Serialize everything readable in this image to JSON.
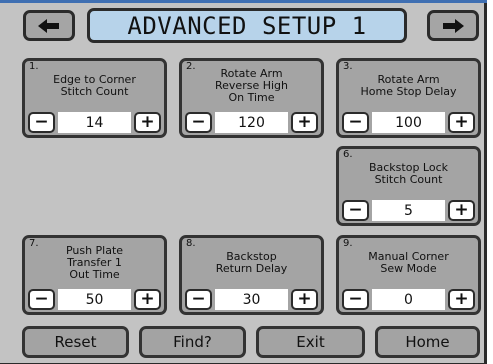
{
  "title": "ADVANCED SETUP 1",
  "nav": {
    "prev_icon": "arrow-left-icon",
    "next_icon": "arrow-right-icon"
  },
  "params": [
    {
      "num": "1.",
      "label": "Edge to Corner\nStitch Count",
      "value": "14"
    },
    {
      "num": "2.",
      "label": "Rotate Arm\nReverse High\nOn Time",
      "value": "120"
    },
    {
      "num": "3.",
      "label": "Rotate Arm\nHome Stop Delay",
      "value": "100"
    },
    {
      "num": "6.",
      "label": "Backstop Lock\nStitch Count",
      "value": "5"
    },
    {
      "num": "7.",
      "label": "Push Plate\nTransfer 1\nOut Time",
      "value": "50"
    },
    {
      "num": "8.",
      "label": "Backstop\nReturn Delay",
      "value": "30"
    },
    {
      "num": "9.",
      "label": "Manual Corner\nSew Mode",
      "value": "0"
    }
  ],
  "stepper": {
    "minus": "−",
    "plus": "+"
  },
  "footer": {
    "reset": "Reset",
    "find": "Find?",
    "exit": "Exit",
    "home": "Home"
  }
}
